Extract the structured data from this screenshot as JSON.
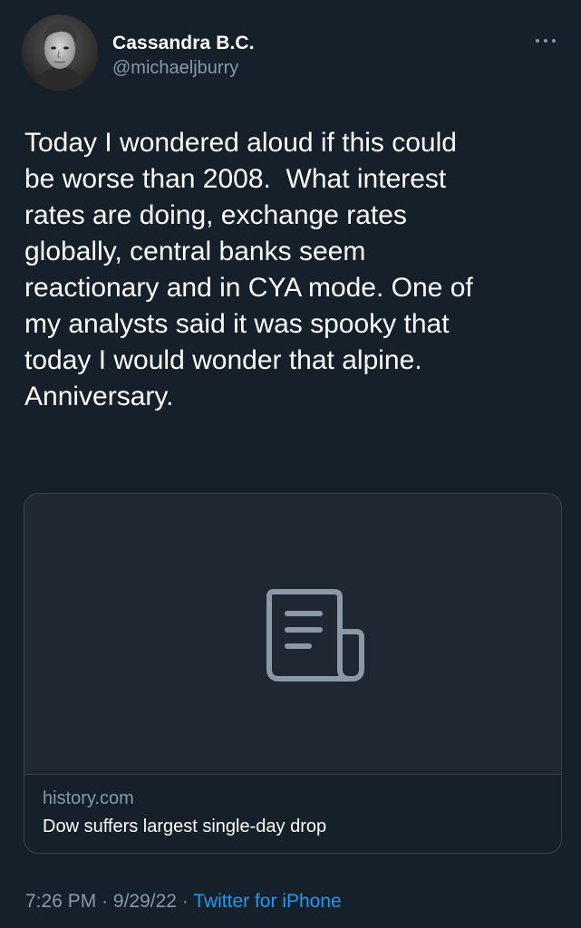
{
  "header": {
    "display_name": "Cassandra B.C.",
    "handle": "@michaeljburry",
    "avatar_icon": "user-avatar-photo",
    "more_icon": "more-options-icon"
  },
  "tweet": {
    "text": "Today I wondered aloud if this could\nbe worse than 2008.  What interest\nrates are doing, exchange rates\nglobally, central banks seem\nreactionary and in CYA mode. One of\nmy analysts said it was spooky that\ntoday I would wonder that alpine.\nAnniversary."
  },
  "card": {
    "domain": "history.com",
    "title": "Dow suffers largest single-day drop",
    "placeholder_icon": "document-icon"
  },
  "meta": {
    "time": "7:26 PM",
    "separator": "·",
    "date": "9/29/22",
    "source": "Twitter for iPhone"
  },
  "colors": {
    "background": "#15202b",
    "text_primary": "#ffffff",
    "text_secondary": "#8b98a5",
    "accent": "#1d9bf0",
    "border": "#38444d"
  }
}
